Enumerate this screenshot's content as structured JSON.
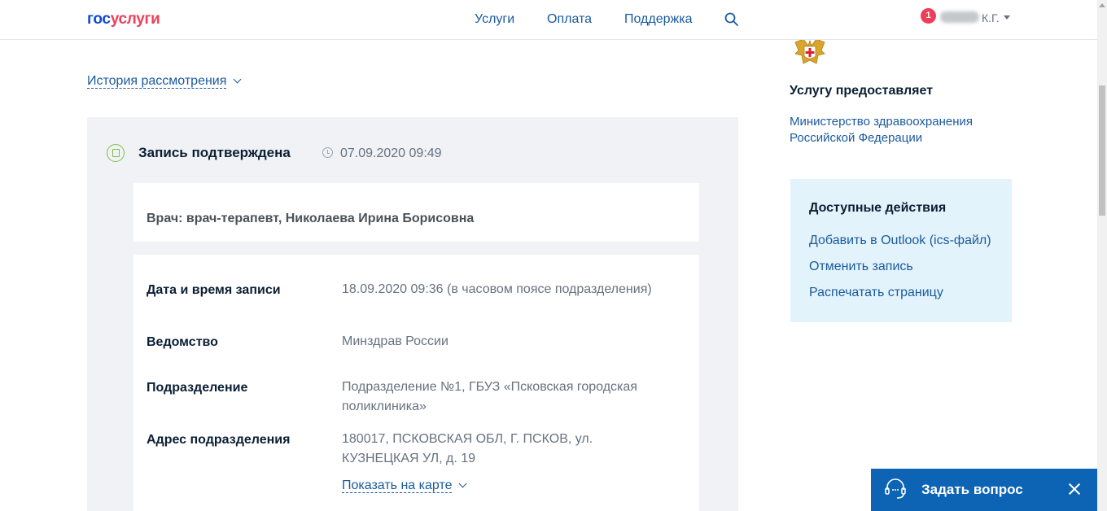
{
  "header": {
    "logo_part1": "гос",
    "logo_part2": "услуги",
    "nav": [
      "Услуги",
      "Оплата",
      "Поддержка"
    ],
    "notification_count": "1",
    "user_initials": "К.Г.",
    "colors": {
      "logo_blue": "#0d4cd3",
      "logo_red": "#ee3f58",
      "link": "#1a5a9e"
    }
  },
  "main": {
    "history_link": "История рассмотрения",
    "status": {
      "text": "Запись подтверждена",
      "datetime": "07.09.2020 09:49",
      "icon": "flag-circle-icon",
      "color": "#80be4a"
    },
    "doctor": "Врач: врач-терапевт, Николаева Ирина Борисовна",
    "details": [
      {
        "label": "Дата и время записи",
        "value": "18.09.2020 09:36 (в часовом поясе подразделения)"
      },
      {
        "label": "Ведомство",
        "value": "Минздрав России"
      },
      {
        "label": "Подразделение",
        "value": "Подразделение №1, ГБУЗ «Псковская городская поликлиника»"
      },
      {
        "label": "Адрес подразделения",
        "value": "180017, ПСКОВСКАЯ ОБЛ, Г. ПСКОВ, ул. КУЗНЕЦКАЯ УЛ, д. 19"
      }
    ],
    "map_link": "Показать на карте"
  },
  "sidebar": {
    "provider_title": "Услугу предоставляет",
    "provider_name": "Министерство здравоохранения Российской Федерации",
    "actions_title": "Доступные действия",
    "actions": [
      "Добавить в Outlook (ics-файл)",
      "Отменить запись",
      "Распечатать страницу"
    ]
  },
  "chat": {
    "label": "Задать вопрос",
    "color": "#0d63b4"
  }
}
